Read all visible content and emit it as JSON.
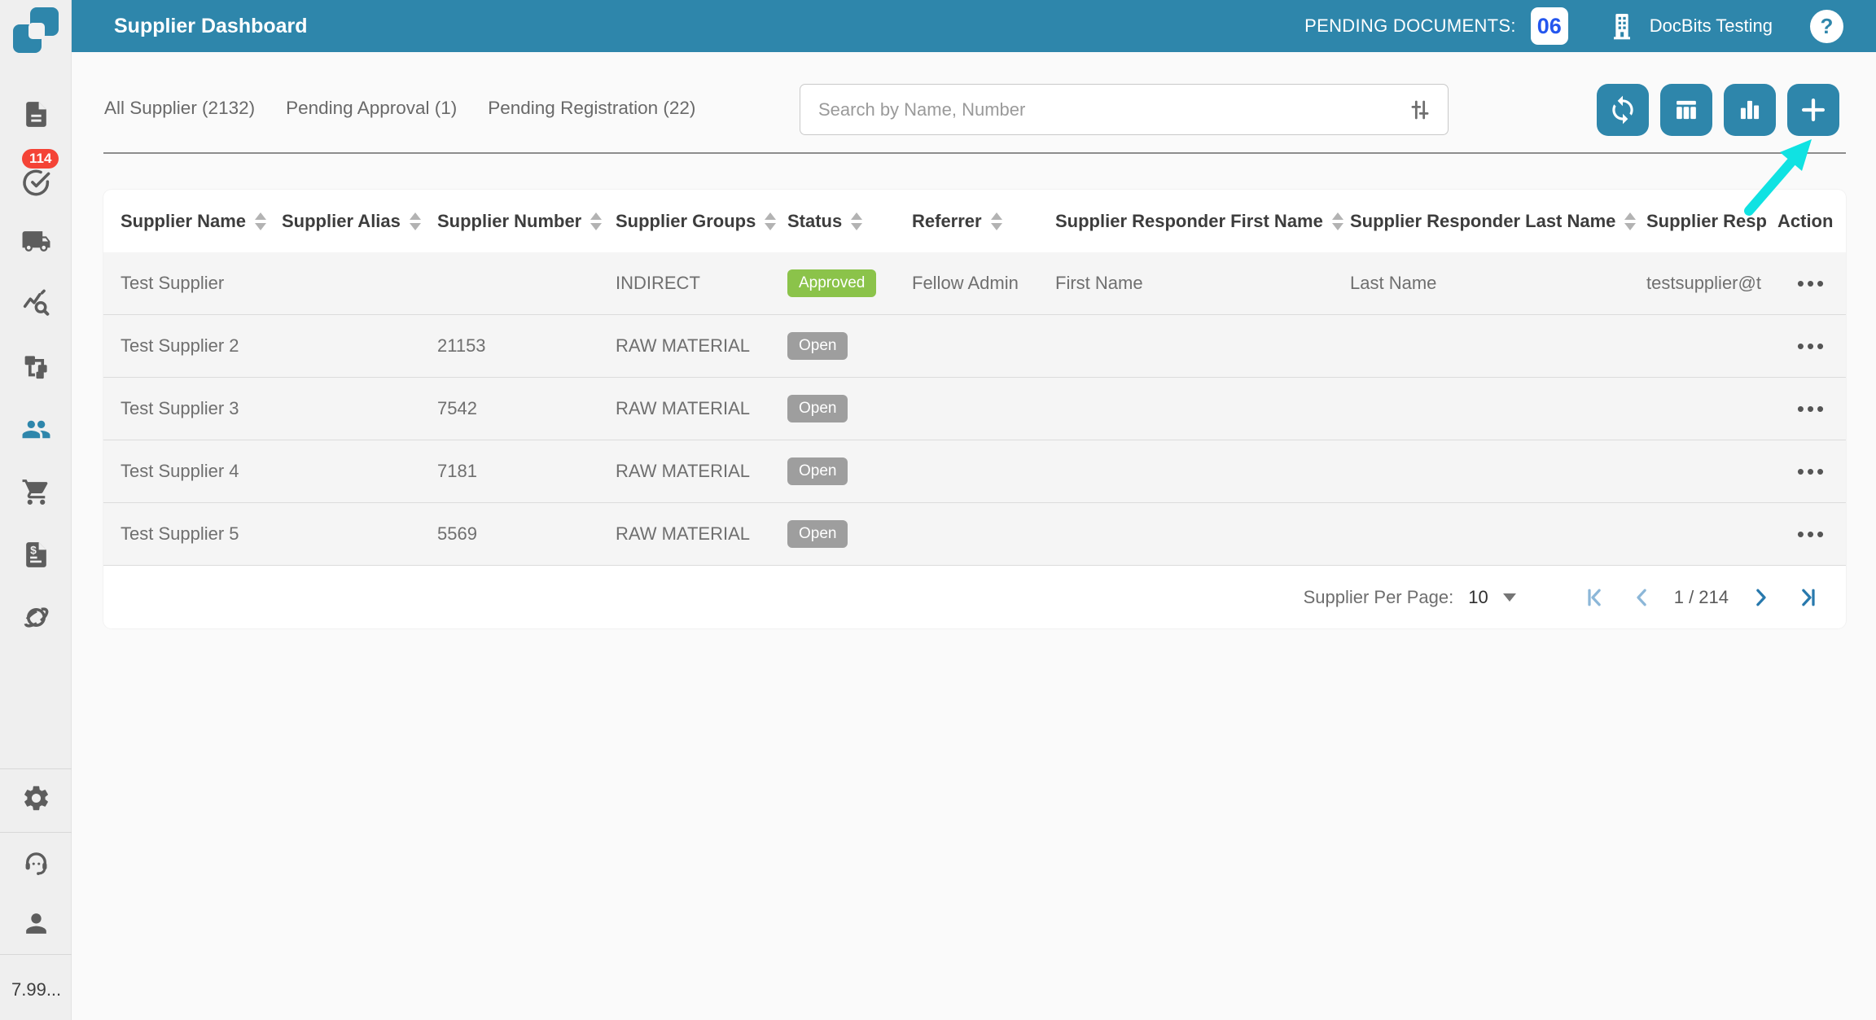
{
  "colors": {
    "accent_teal": "#2e86ab",
    "pending_count_blue": "#2456ee",
    "alert_red": "#f44336",
    "approved_green": "#8bc34a",
    "open_gray": "#9e9e9e",
    "annotation_cyan": "#10e2e2",
    "pager_disabled_blue": "#8cb7d8",
    "pager_active_blue": "#2879ad"
  },
  "header": {
    "title": "Supplier Dashboard",
    "pending_label": "PENDING DOCUMENTS:",
    "pending_count": "06",
    "org_name": "DocBits Testing",
    "help_glyph": "?"
  },
  "sidebar": {
    "approvals_badge": "114",
    "version": "7.99...",
    "items": [
      {
        "icon": "document-icon"
      },
      {
        "icon": "approvals-check-icon",
        "badge": "114"
      },
      {
        "icon": "shipping-truck-icon"
      },
      {
        "icon": "analytics-icon"
      },
      {
        "icon": "workflow-icon"
      },
      {
        "icon": "suppliers-people-icon",
        "active": true
      },
      {
        "icon": "purchase-cart-icon"
      },
      {
        "icon": "invoice-icon"
      },
      {
        "icon": "integrations-orbit-icon"
      },
      {
        "icon": "settings-gear-icon"
      },
      {
        "icon": "support-headset-icon"
      },
      {
        "icon": "profile-person-icon"
      }
    ]
  },
  "tabs": [
    {
      "label": "All Supplier (2132)"
    },
    {
      "label": "Pending Approval (1)"
    },
    {
      "label": "Pending Registration (22)"
    }
  ],
  "search": {
    "placeholder": "Search by Name, Number"
  },
  "icons": {
    "action_menu": "•••"
  },
  "table": {
    "columns": [
      {
        "label": "Supplier Name",
        "sortable": true
      },
      {
        "label": "Supplier Alias",
        "sortable": true
      },
      {
        "label": "Supplier Number",
        "sortable": true
      },
      {
        "label": "Supplier Groups",
        "sortable": true
      },
      {
        "label": "Status",
        "sortable": true
      },
      {
        "label": "Referrer",
        "sortable": true
      },
      {
        "label": "Supplier Responder First Name",
        "sortable": true
      },
      {
        "label": "Supplier Responder Last Name",
        "sortable": true
      },
      {
        "label": "Supplier Resp",
        "sortable": false
      },
      {
        "label": "Action",
        "sortable": false
      }
    ],
    "status_styles": {
      "Approved": "#8bc34a",
      "Open": "#9e9e9e"
    },
    "rows": [
      {
        "name": "Test Supplier",
        "alias": "",
        "number": "",
        "groups": "INDIRECT",
        "status": "Approved",
        "referrer": "Fellow Admin",
        "responder_first": "First Name",
        "responder_last": "Last Name",
        "responder_email": "testsupplier@t"
      },
      {
        "name": "Test Supplier 2",
        "alias": "",
        "number": "21153",
        "groups": "RAW MATERIAL",
        "status": "Open",
        "referrer": "",
        "responder_first": "",
        "responder_last": "",
        "responder_email": ""
      },
      {
        "name": "Test Supplier 3",
        "alias": "",
        "number": "7542",
        "groups": "RAW MATERIAL",
        "status": "Open",
        "referrer": "",
        "responder_first": "",
        "responder_last": "",
        "responder_email": ""
      },
      {
        "name": "Test Supplier 4",
        "alias": "",
        "number": "7181",
        "groups": "RAW MATERIAL",
        "status": "Open",
        "referrer": "",
        "responder_first": "",
        "responder_last": "",
        "responder_email": ""
      },
      {
        "name": "Test Supplier 5",
        "alias": "",
        "number": "5569",
        "groups": "RAW MATERIAL",
        "status": "Open",
        "referrer": "",
        "responder_first": "",
        "responder_last": "",
        "responder_email": ""
      }
    ]
  },
  "pagination": {
    "per_page_label": "Supplier Per Page:",
    "per_page_value": "10",
    "page_info": "1 / 214"
  }
}
